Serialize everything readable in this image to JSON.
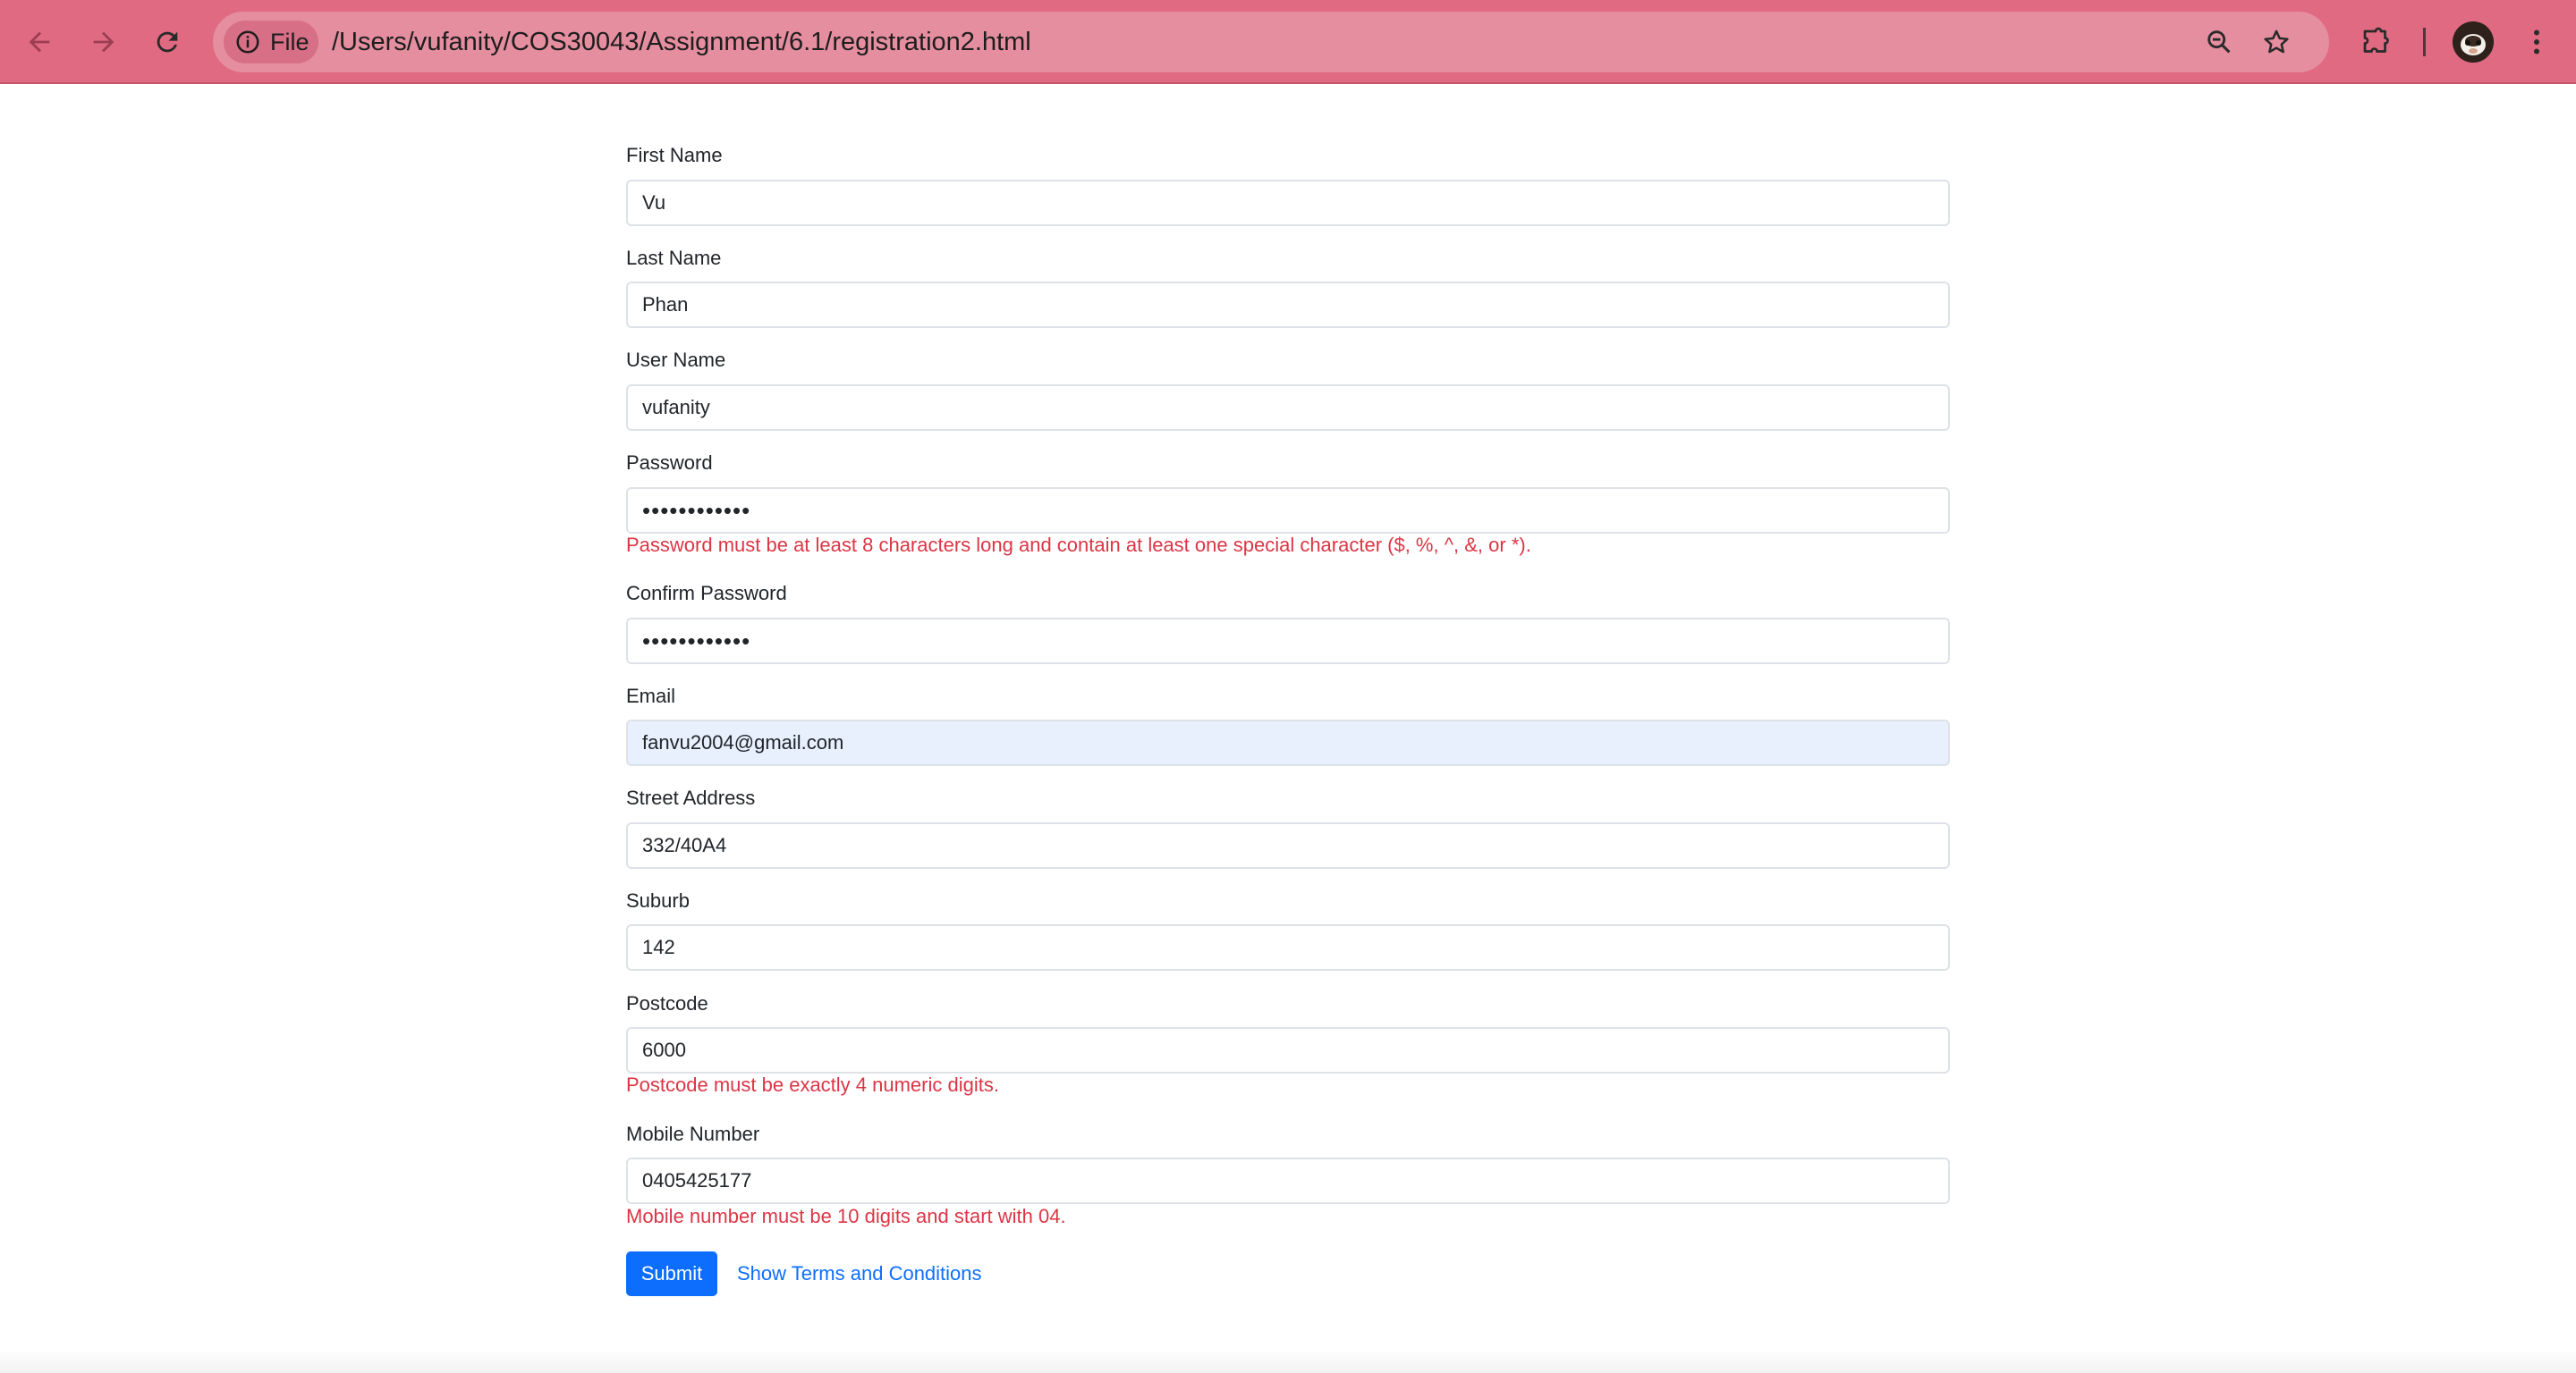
{
  "browser": {
    "chip_label": "File",
    "url": "/Users/vufanity/COS30043/Assignment/6.1/registration2.html",
    "icons": {
      "back": "arrow-left-icon",
      "forward": "arrow-right-icon",
      "reload": "reload-icon",
      "info": "info-icon",
      "zoom": "zoom-out-icon",
      "bookmark": "star-icon",
      "extensions": "puzzle-icon",
      "profile": "avatar",
      "menu": "kebab-menu-icon"
    },
    "toolbar_color": "#e06a82"
  },
  "form": {
    "fields": [
      {
        "label": "First Name",
        "value": "Vu"
      },
      {
        "label": "Last Name",
        "value": "Phan"
      },
      {
        "label": "User Name",
        "value": "vufanity"
      },
      {
        "label": "Password",
        "value": "••••••••••••",
        "error": "Password must be at least 8 characters long and contain at least one special character ($, %, ^, &, or *)."
      },
      {
        "label": "Confirm Password",
        "value": "••••••••••••"
      },
      {
        "label": "Email",
        "value": "fanvu2004@gmail.com"
      },
      {
        "label": "Street Address",
        "value": "332/40A4"
      },
      {
        "label": "Suburb",
        "value": "142"
      },
      {
        "label": "Postcode",
        "value": "6000",
        "error": "Postcode must be exactly 4 numeric digits."
      },
      {
        "label": "Mobile Number",
        "value": "0405425177",
        "error": "Mobile number must be 10 digits and start with 04."
      }
    ],
    "submit_label": "Submit",
    "terms_link": "Show Terms and Conditions",
    "colors": {
      "primary": "#0d6efd",
      "error": "#dc3545",
      "autofill": "#e8f0fe"
    }
  }
}
